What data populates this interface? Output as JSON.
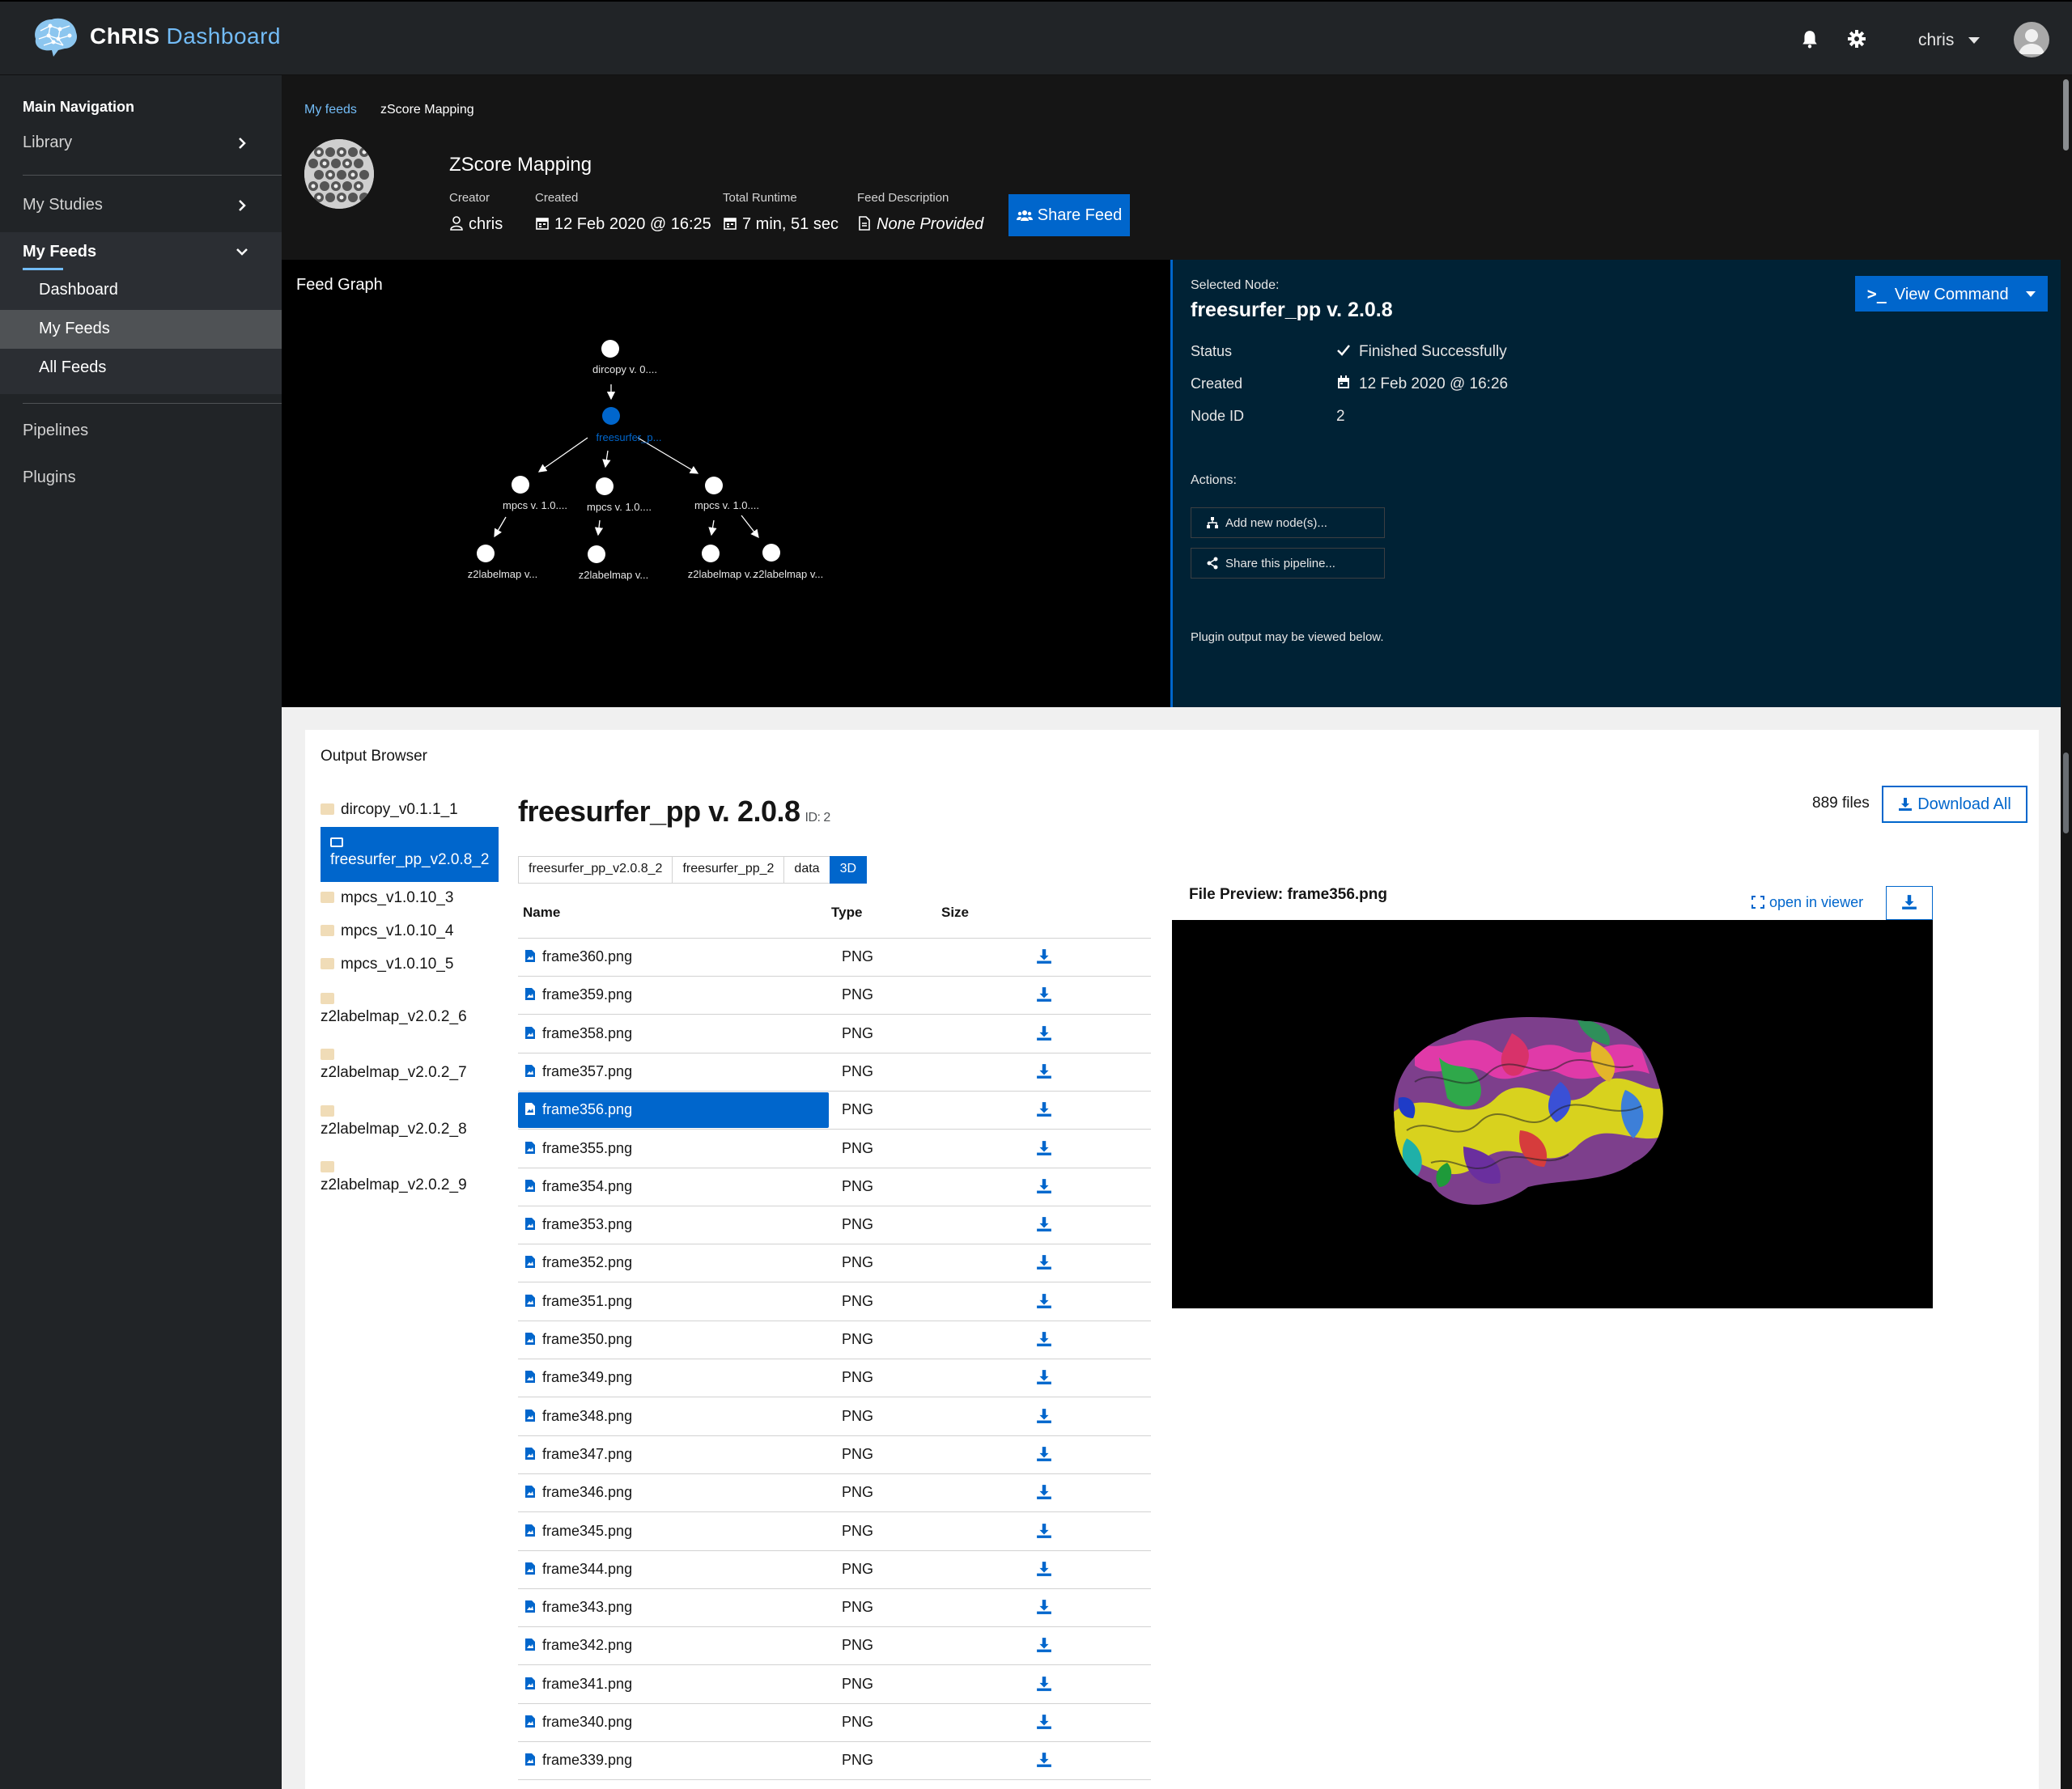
{
  "header": {
    "brand_name": "ChRIS",
    "brand_sub": "Dashboard",
    "user": "chris"
  },
  "sidebar": {
    "title": "Main Navigation",
    "items": [
      {
        "label": "Library"
      },
      {
        "label": "My Studies"
      },
      {
        "label": "My Feeds"
      },
      {
        "label": "Pipelines"
      },
      {
        "label": "Plugins"
      }
    ],
    "subitems": [
      {
        "label": "Dashboard"
      },
      {
        "label": "My Feeds"
      },
      {
        "label": "All Feeds"
      }
    ]
  },
  "feed": {
    "breadcrumb": [
      "My feeds",
      "zScore Mapping"
    ],
    "title": "ZScore Mapping",
    "meta": [
      {
        "label": "Creator",
        "value": "chris"
      },
      {
        "label": "Created",
        "value": "12 Feb 2020 @ 16:25"
      },
      {
        "label": "Total Runtime",
        "value": "7 min, 51 sec"
      },
      {
        "label": "Feed Description",
        "value": "None Provided"
      }
    ],
    "share_label": "Share Feed"
  },
  "graph": {
    "title": "Feed Graph",
    "nodes": [
      {
        "label": "dircopy v. 0...."
      },
      {
        "label": "freesurfer_p..."
      },
      {
        "label": "mpcs v. 1.0...."
      },
      {
        "label": "mpcs v. 1.0...."
      },
      {
        "label": "mpcs v. 1.0...."
      },
      {
        "label": "z2labelmap v..."
      },
      {
        "label": "z2labelmap v..."
      },
      {
        "label": "z2labelmap v..."
      },
      {
        "label": "z2labelmap v..."
      }
    ]
  },
  "node": {
    "selected_label": "Selected Node:",
    "name": "freesurfer_pp v. 2.0.8",
    "view_command": "View Command",
    "status_label": "Status",
    "status_value": "Finished Successfully",
    "created_label": "Created",
    "created_value": "12 Feb 2020 @ 16:26",
    "id_label": "Node ID",
    "id_value": "2",
    "actions_label": "Actions:",
    "add_node": "Add new node(s)...",
    "share_pipeline": "Share this pipeline...",
    "note": "Plugin output may be viewed below."
  },
  "output": {
    "title": "Output Browser",
    "dirs": [
      {
        "name": "dircopy_v0.1.1_1"
      },
      {
        "name": "freesurfer_pp_v2.0.8_2"
      },
      {
        "name": "mpcs_v1.0.10_3"
      },
      {
        "name": "mpcs_v1.0.10_4"
      },
      {
        "name": "mpcs_v1.0.10_5"
      },
      {
        "name": "z2labelmap_v2.0.2_6"
      },
      {
        "name": "z2labelmap_v2.0.2_7"
      },
      {
        "name": "z2labelmap_v2.0.2_8"
      },
      {
        "name": "z2labelmap_v2.0.2_9"
      }
    ],
    "node_title": "freesurfer_pp v. 2.0.8",
    "node_id": "ID: 2",
    "files_count": "889 files",
    "download_all": "Download All",
    "path": [
      "freesurfer_pp_v2.0.8_2",
      "freesurfer_pp_2",
      "data",
      "3D"
    ],
    "columns": {
      "name": "Name",
      "type": "Type",
      "size": "Size"
    },
    "files": [
      {
        "name": "frame360.png",
        "type": "PNG"
      },
      {
        "name": "frame359.png",
        "type": "PNG"
      },
      {
        "name": "frame358.png",
        "type": "PNG"
      },
      {
        "name": "frame357.png",
        "type": "PNG"
      },
      {
        "name": "frame356.png",
        "type": "PNG"
      },
      {
        "name": "frame355.png",
        "type": "PNG"
      },
      {
        "name": "frame354.png",
        "type": "PNG"
      },
      {
        "name": "frame353.png",
        "type": "PNG"
      },
      {
        "name": "frame352.png",
        "type": "PNG"
      },
      {
        "name": "frame351.png",
        "type": "PNG"
      },
      {
        "name": "frame350.png",
        "type": "PNG"
      },
      {
        "name": "frame349.png",
        "type": "PNG"
      },
      {
        "name": "frame348.png",
        "type": "PNG"
      },
      {
        "name": "frame347.png",
        "type": "PNG"
      },
      {
        "name": "frame346.png",
        "type": "PNG"
      },
      {
        "name": "frame345.png",
        "type": "PNG"
      },
      {
        "name": "frame344.png",
        "type": "PNG"
      },
      {
        "name": "frame343.png",
        "type": "PNG"
      },
      {
        "name": "frame342.png",
        "type": "PNG"
      },
      {
        "name": "frame341.png",
        "type": "PNG"
      },
      {
        "name": "frame340.png",
        "type": "PNG"
      },
      {
        "name": "frame339.png",
        "type": "PNG"
      }
    ],
    "preview_title": "File Preview: frame356.png",
    "open_viewer": "open in viewer"
  },
  "colors": {
    "accent": "#0066cc",
    "link": "#73bcf7",
    "header_bg": "#212427",
    "panel_bg": "#002235"
  }
}
